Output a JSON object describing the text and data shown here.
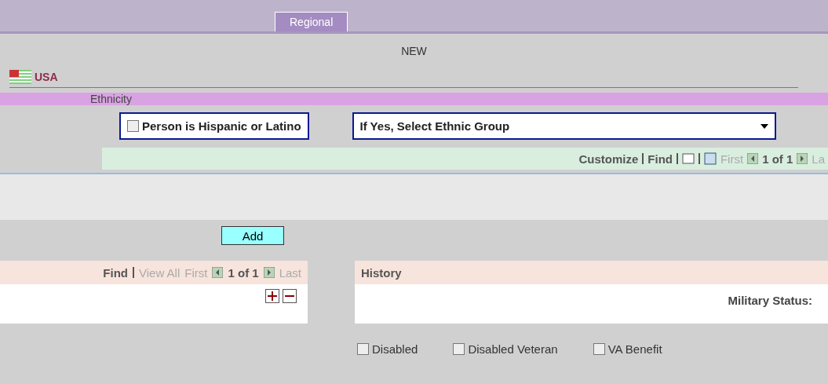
{
  "tabs": [
    {
      "label": "Regional",
      "selected": true
    }
  ],
  "status": "NEW",
  "country": {
    "name": "USA"
  },
  "ethnicity": {
    "title": "Ethnicity",
    "hispanic": {
      "label": "Person is Hispanic or Latino",
      "checked": false
    },
    "ethnic_group": {
      "label": "If Yes, Select Ethnic Group"
    }
  },
  "grid_nav": {
    "customize": "Customize",
    "find": "Find",
    "first": "First",
    "count": "1 of 1",
    "last": "La"
  },
  "add_button": "Add",
  "left_nav": {
    "find": "Find",
    "view_all": "View All",
    "first": "First",
    "count": "1 of 1",
    "last": "Last"
  },
  "history": {
    "title": "History",
    "military_label": "Military Status:"
  },
  "checks": [
    {
      "label": "Disabled",
      "checked": false
    },
    {
      "label": "Disabled Veteran",
      "checked": false
    },
    {
      "label": "VA Benefit",
      "checked": false
    }
  ]
}
